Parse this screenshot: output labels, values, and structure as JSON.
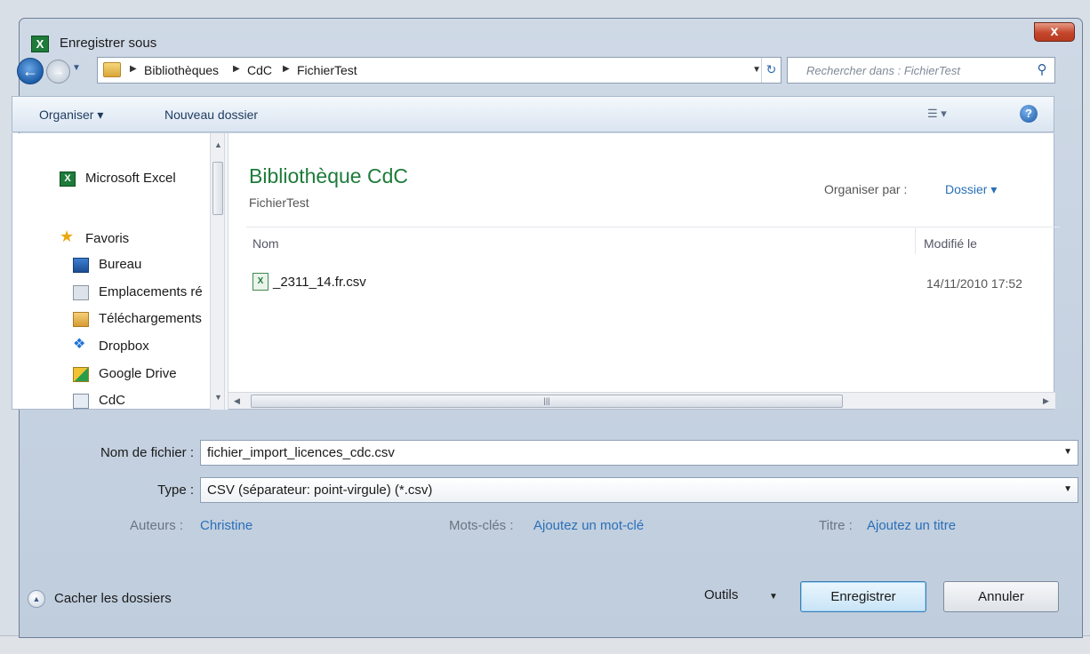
{
  "window": {
    "title": "Enregistrer sous",
    "app_icon": "X",
    "close_label": "x"
  },
  "address_bar": {
    "breadcrumbs": [
      "Bibliothèques",
      "CdC",
      "FichierTest"
    ],
    "search_placeholder": "Rechercher dans : FichierTest"
  },
  "toolbar": {
    "organize_label": "Organiser ▾",
    "new_folder_label": "Nouveau dossier"
  },
  "nav_pane": {
    "items": [
      {
        "label": "Microsoft Excel",
        "icon": "excel-icon"
      },
      {
        "label": "Favoris",
        "icon": "star-icon"
      },
      {
        "label": "Bureau",
        "icon": "desktop-icon"
      },
      {
        "label": "Emplacements ré",
        "icon": "recent-places-icon"
      },
      {
        "label": "Téléchargements",
        "icon": "downloads-icon"
      },
      {
        "label": "Dropbox",
        "icon": "dropbox-icon"
      },
      {
        "label": "Google Drive",
        "icon": "google-drive-icon"
      },
      {
        "label": "CdC",
        "icon": "library-icon"
      }
    ]
  },
  "library": {
    "title": "Bibliothèque CdC",
    "subtitle": "FichierTest",
    "arrange_label": "Organiser par :",
    "arrange_value": "Dossier ▾"
  },
  "columns": {
    "name": "Nom",
    "modified": "Modifié le"
  },
  "files": [
    {
      "name": "_2311_14.fr.csv",
      "modified": "14/11/2010 17:52",
      "icon": "csv-file-icon"
    }
  ],
  "form": {
    "filename_label": "Nom de fichier :",
    "filename_value": "fichier_import_licences_cdc.csv",
    "type_label": "Type :",
    "type_value": "CSV (séparateur: point-virgule) (*.csv)"
  },
  "metadata": {
    "authors_label": "Auteurs :",
    "authors_value": "Christine",
    "keywords_label": "Mots-clés :",
    "keywords_value": "Ajoutez un mot-clé",
    "title_label": "Titre :",
    "title_value": "Ajoutez un titre"
  },
  "footer": {
    "hide_folders_label": "Cacher les dossiers",
    "tools_label": "Outils",
    "save_label": "Enregistrer",
    "cancel_label": "Annuler"
  },
  "colors": {
    "library_title": "#1e7b3a",
    "link": "#2a6fb8",
    "close_button": "#c4472c"
  }
}
